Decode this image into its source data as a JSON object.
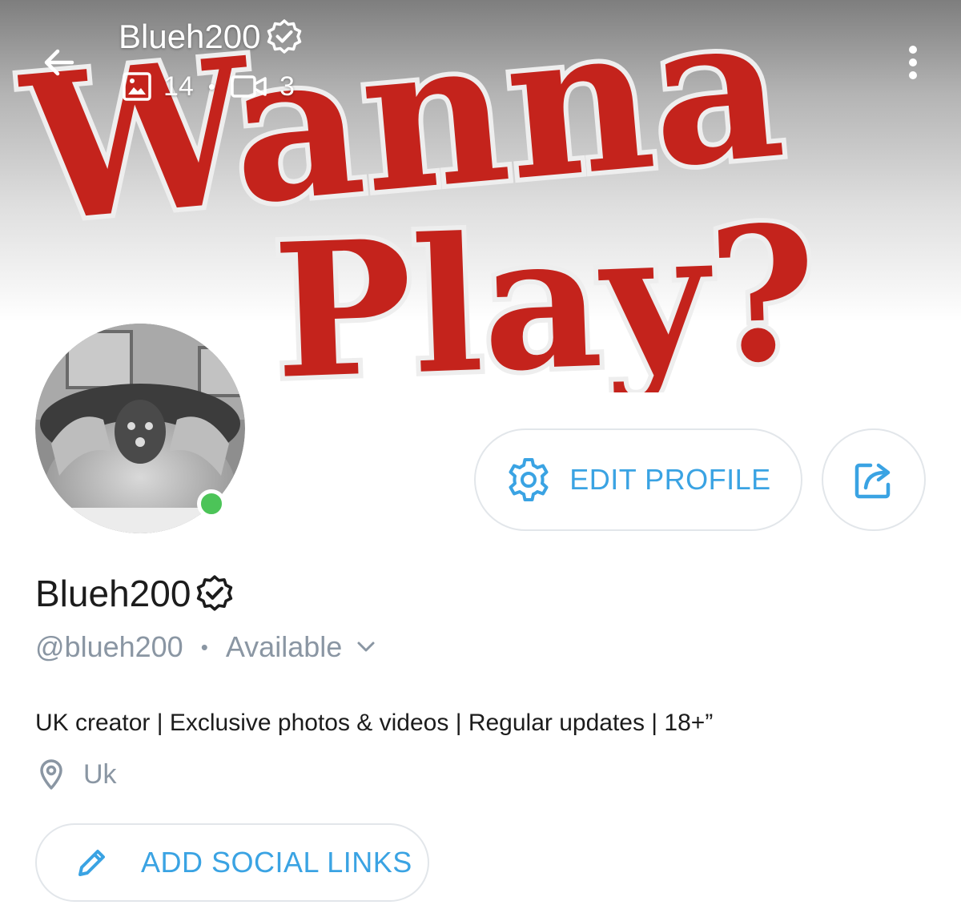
{
  "header": {
    "title": "Blueh200",
    "photo_count": "14",
    "video_count": "3",
    "separator": "•"
  },
  "cover": {
    "line1": "Wanna",
    "line2": "Play?"
  },
  "profile": {
    "display_name": "Blueh200",
    "handle": "@blueh200",
    "separator": "•",
    "status": "Available",
    "bio": "UK creator | Exclusive photos & videos | Regular updates | 18+”",
    "location": "Uk",
    "online": true
  },
  "actions": {
    "edit_profile_label": "EDIT PROFILE",
    "add_social_label": "ADD SOCIAL LINKS"
  },
  "colors": {
    "accent": "#3aa3e3",
    "muted": "#8a96a3",
    "online": "#4cc458",
    "cover_red": "#c4231c"
  },
  "icons": {
    "back": "arrow-left-icon",
    "menu": "more-vertical-icon",
    "verified": "verified-badge-icon",
    "photos": "image-icon",
    "videos": "video-icon",
    "settings": "gear-icon",
    "share": "share-icon",
    "status_dropdown": "chevron-down-icon",
    "location": "map-pin-icon",
    "edit": "pencil-icon"
  }
}
